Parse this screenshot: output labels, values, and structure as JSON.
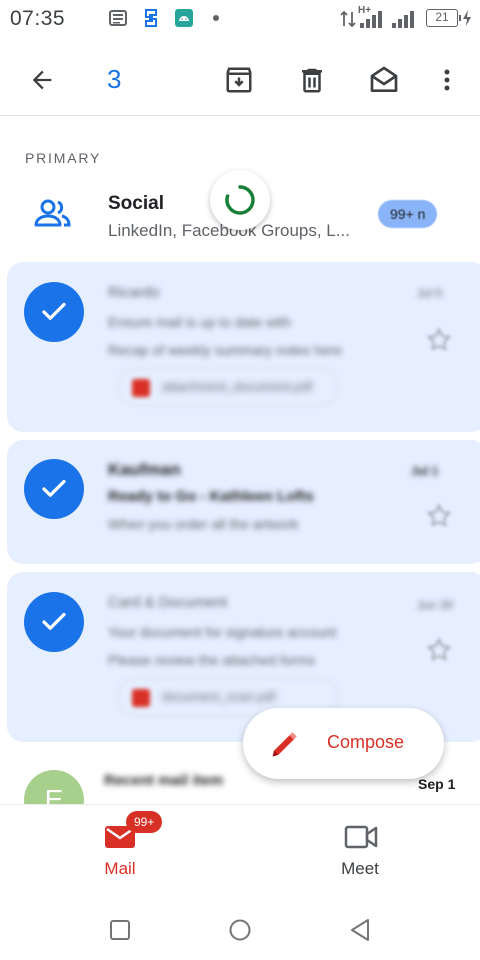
{
  "status_bar": {
    "time": "07:35",
    "network_label": "H+",
    "battery_level": "21",
    "icons": [
      "news-icon",
      "sync-app-icon",
      "android-icon",
      "dot-icon",
      "data-arrows-icon",
      "signal-icon",
      "battery-icon",
      "charging-icon"
    ]
  },
  "toolbar": {
    "selected_count": "3",
    "icons": [
      "back-arrow-icon",
      "archive-icon",
      "delete-icon",
      "mark-read-icon",
      "more-icon"
    ]
  },
  "section": {
    "label": "PRIMARY"
  },
  "social": {
    "title": "Social",
    "subtitle": "LinkedIn, Facebook Groups, L...",
    "badge": "99+ n",
    "icon": "people-icon"
  },
  "mail_items": [
    {
      "sender": "Ricardo",
      "snippet_1": "Ensure mail is up to date with",
      "snippet_2": "Recap of weekly summary notes here",
      "date": "Jul 5",
      "attachment": "attachment_document.pdf"
    },
    {
      "sender": "Kaufman",
      "snippet_1": "Ready to Go - Kathleen Lofts",
      "snippet_2": "When you order all the artwork",
      "date": "Jul 1"
    },
    {
      "sender": "Card & Document",
      "snippet_1": "Your document for signature account",
      "snippet_2": "Please review the attached forms",
      "date": "Jun 30",
      "attachment": "document_scan.pdf"
    }
  ],
  "last_item": {
    "avatar_letter": "E",
    "sender": "Recent mail item",
    "date": "Sep 1"
  },
  "compose": {
    "label": "Compose",
    "icon": "pencil-icon"
  },
  "bottom_nav": {
    "mail_label": "Mail",
    "mail_badge": "99+",
    "meet_label": "Meet"
  },
  "colors": {
    "accent_blue": "#1a73e8",
    "accent_red": "#d93025",
    "selected_bg": "#e6efff",
    "spinner_green": "#188038"
  }
}
